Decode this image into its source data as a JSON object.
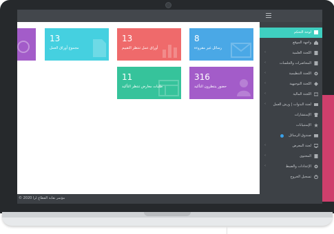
{
  "colors": {
    "topbar": "#43474c",
    "sidebar": "#3d4146",
    "active": "#3fcfc0",
    "blue": "#4aa8e6",
    "red": "#ef6a6b",
    "cyan": "#45d0e0",
    "purple": "#a35cc9",
    "green": "#36c39b",
    "pink": "#cf3f6c"
  },
  "tiles": [
    {
      "number": "8",
      "label": "رسائل غير مقروءة",
      "icon": "envelope-icon"
    },
    {
      "number": "13",
      "label": "أوراق عمل تنتظر التقييم",
      "icon": "bar-chart-icon"
    },
    {
      "number": "13",
      "label": "مجموع أوراق العمل",
      "icon": "document-icon"
    },
    {
      "number": "",
      "label": "",
      "icon": "users-icon"
    },
    {
      "number": "316",
      "label": "حضور ينتظرون التأكيد",
      "icon": "person-icon"
    },
    {
      "number": "11",
      "label": "طلبات معارض تنتظر التأكيد",
      "icon": "grid-icon"
    }
  ],
  "sidebar": {
    "items": [
      {
        "label": "لوحة التحكم",
        "icon": "dashboard-icon",
        "active": true
      },
      {
        "label": "واجهة الموقع",
        "icon": "home-icon"
      },
      {
        "label": "اللجنة العلمية",
        "icon": "document-icon",
        "has_children": true
      },
      {
        "label": "المحاضرات والجلسات",
        "icon": "document-icon",
        "has_children": true
      },
      {
        "label": "اللجنة التنظيمية",
        "icon": "gear-icon",
        "has_children": true
      },
      {
        "label": "اللجنة التوجيهية",
        "icon": "diamond-icon",
        "has_children": true
      },
      {
        "label": "اللجنة المالية",
        "icon": "money-icon",
        "has_children": true
      },
      {
        "label": "لجنة الندوات | ورش العمل",
        "icon": "card-icon",
        "has_children": true
      },
      {
        "label": "الإستشارات",
        "icon": "shirt-icon"
      },
      {
        "label": "الإستبيانات",
        "icon": "star-icon"
      },
      {
        "label": "صندوق الرسائل",
        "icon": "inbox-icon",
        "badge": true
      },
      {
        "label": "لجنة المعرض",
        "icon": "monitor-icon",
        "has_children": true
      },
      {
        "label": "المحتوى",
        "icon": "document-icon",
        "has_children": true
      },
      {
        "label": "الإعدادات والضبط",
        "icon": "gear-icon",
        "has_children": true
      },
      {
        "label": "تسجيل الخروج",
        "icon": "power-icon"
      }
    ]
  },
  "footer": {
    "text": "© 2020 مؤتمر نقابة القطاع لرا"
  }
}
